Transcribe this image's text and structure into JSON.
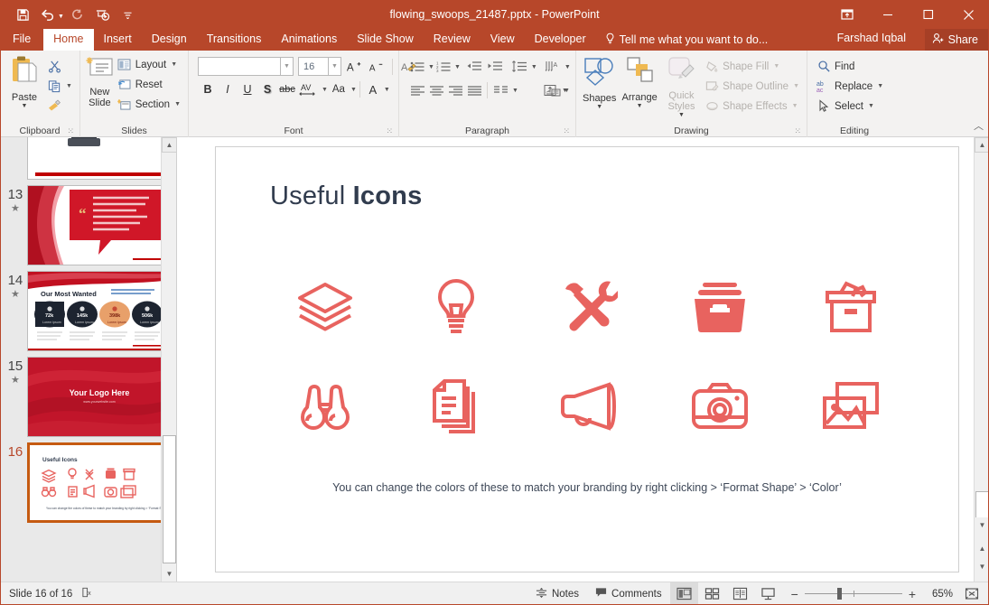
{
  "window": {
    "title": "flowing_swoops_21487.pptx - PowerPoint",
    "accent_color": "#B7472A",
    "quick_access": [
      {
        "name": "save",
        "glyph": "save-icon"
      },
      {
        "name": "undo",
        "glyph": "undo-icon"
      },
      {
        "name": "redo",
        "glyph": "redo-icon"
      },
      {
        "name": "start-from-beginning",
        "glyph": "slideshow-icon"
      },
      {
        "name": "customize-quick-access-toolbar",
        "glyph": "chevron-down-icon"
      }
    ],
    "controls": {
      "ribbon_display_options": "ribbon-options-icon",
      "minimize": "minimize-icon",
      "restore": "restore-icon",
      "close": "close-icon"
    }
  },
  "tabs": [
    {
      "label": "File",
      "active": false
    },
    {
      "label": "Home",
      "active": true
    },
    {
      "label": "Insert",
      "active": false
    },
    {
      "label": "Design",
      "active": false
    },
    {
      "label": "Transitions",
      "active": false
    },
    {
      "label": "Animations",
      "active": false
    },
    {
      "label": "Slide Show",
      "active": false
    },
    {
      "label": "Review",
      "active": false
    },
    {
      "label": "View",
      "active": false
    },
    {
      "label": "Developer",
      "active": false
    }
  ],
  "tellme": {
    "label": "Tell me what you want to do..."
  },
  "account": {
    "user": "Farshad Iqbal",
    "share_label": "Share"
  },
  "ribbon": {
    "clipboard": {
      "label": "Clipboard",
      "paste": "Paste",
      "cut": "cut-icon",
      "copy": "copy-icon",
      "format_painter": "format-painter-icon"
    },
    "slides": {
      "label": "Slides",
      "new_slide": "New Slide",
      "layout": "Layout",
      "reset": "Reset",
      "section": "Section"
    },
    "font": {
      "label": "Font",
      "font_name": "",
      "font_name_placeholder": "",
      "font_size": "16",
      "increase_font": "A",
      "decrease_font": "A",
      "clear_formatting": "clear-formatting-icon",
      "bold": "B",
      "italic": "I",
      "underline": "U",
      "shadow": "S",
      "strikethrough": "abc",
      "character_spacing": "AV",
      "change_case": "Aa",
      "font_color": "A"
    },
    "paragraph": {
      "label": "Paragraph",
      "bullets": "bullets-icon",
      "numbering": "numbering-icon",
      "decrease_indent": "decrease-indent-icon",
      "increase_indent": "increase-indent-icon",
      "line_spacing": "line-spacing-icon",
      "text_direction": "text-direction-icon",
      "align_text": "align-text-icon",
      "convert_smartart": "smartart-icon",
      "align_left": "align-left-icon",
      "align_center": "align-center-icon",
      "align_right": "align-right-icon",
      "justify": "justify-icon",
      "columns": "columns-icon"
    },
    "drawing": {
      "label": "Drawing",
      "shapes": "Shapes",
      "arrange": "Arrange",
      "quick_styles": "Quick Styles",
      "shape_fill": "Shape Fill",
      "shape_outline": "Shape Outline",
      "shape_effects": "Shape Effects"
    },
    "editing": {
      "label": "Editing",
      "find": "Find",
      "replace": "Replace",
      "select": "Select"
    },
    "collapse_ribbon": "collapse-ribbon-icon"
  },
  "thumbnails": [
    {
      "number": "12",
      "starred": true,
      "selected": false,
      "kind": "product",
      "title": ""
    },
    {
      "number": "13",
      "starred": true,
      "selected": false,
      "kind": "quote",
      "quote": "Lorem ipsum dolor sit amet, facilisi repudiandae vis cu, cum ei alterum argumentum necessitatibus. In dicat alienum ius. Enim ridens.\""
    },
    {
      "number": "14",
      "starred": true,
      "selected": false,
      "kind": "stats",
      "title": "Our Most Wanted",
      "stats": [
        "72k",
        "145k",
        "398k",
        "506k"
      ]
    },
    {
      "number": "15",
      "starred": true,
      "selected": false,
      "kind": "logo",
      "logo_text": "Your Logo Here",
      "logo_sub": "www.yourwebsite.com"
    },
    {
      "number": "16",
      "starred": false,
      "selected": true,
      "kind": "icons",
      "title": "Useful Icons"
    }
  ],
  "slide": {
    "title_regular": "Useful ",
    "title_bold": "Icons",
    "icon_color": "#E8635F",
    "title_color": "#313c4e",
    "icons": [
      {
        "name": "layers-icon",
        "label": "layers"
      },
      {
        "name": "lightbulb-icon",
        "label": "lightbulb"
      },
      {
        "name": "tools-icon",
        "label": "hammer and wrench"
      },
      {
        "name": "filebox-icon",
        "label": "file box"
      },
      {
        "name": "archive-box-icon",
        "label": "archive box"
      },
      {
        "name": "binoculars-icon",
        "label": "binoculars"
      },
      {
        "name": "documents-icon",
        "label": "documents"
      },
      {
        "name": "megaphone-icon",
        "label": "megaphone"
      },
      {
        "name": "camera-icon",
        "label": "camera"
      },
      {
        "name": "photos-icon",
        "label": "photos"
      }
    ],
    "caption": "You can change the colors of these to match your branding by right clicking > ‘Format Shape’ > ‘Color’"
  },
  "statusbar": {
    "slide_indicator": "Slide 16 of 16",
    "language_icon": "accessibility-icon",
    "notes": "Notes",
    "comments": "Comments",
    "views": [
      {
        "name": "normal-view",
        "active": true
      },
      {
        "name": "slide-sorter-view",
        "active": false
      },
      {
        "name": "reading-view",
        "active": false
      },
      {
        "name": "slide-show-view",
        "active": false
      }
    ],
    "zoom_out": "−",
    "zoom_in": "+",
    "zoom_level": "65%",
    "fit_slide": "fit-slide-icon"
  }
}
